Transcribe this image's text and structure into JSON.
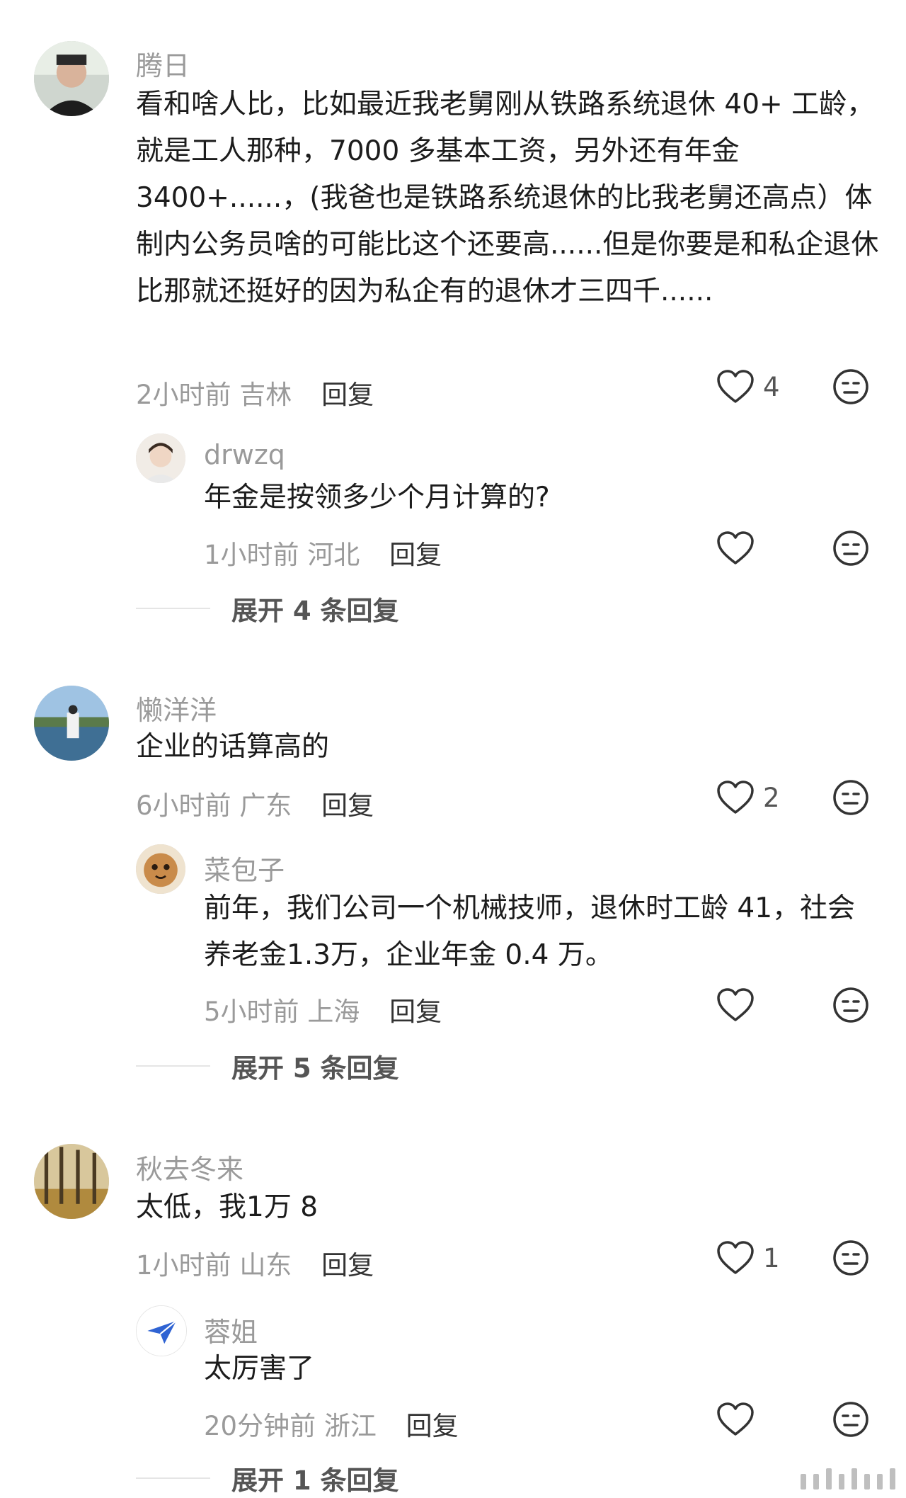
{
  "comments": [
    {
      "user": "腾日",
      "text": "看和啥人比，比如最近我老舅刚从铁路系统退休 40+ 工龄，就是工人那种，7000 多基本工资，另外还有年金 3400+......，(我爸也是铁路系统退休的比我老舅还高点）体制内公务员啥的可能比这个还要高......但是你要是和私企退休比那就还挺好的因为私企有的退休才三四千......",
      "time": "2小时前",
      "location": "吉林",
      "reply": "回复",
      "likes": "4",
      "sub": {
        "user": "drwzq",
        "text": "年金是按领多少个月计算的?",
        "time": "1小时前",
        "location": "河北",
        "reply": "回复"
      },
      "expand": "展开 4 条回复"
    },
    {
      "user": "懒洋洋",
      "text": "企业的话算高的",
      "time": "6小时前",
      "location": "广东",
      "reply": "回复",
      "likes": "2",
      "sub": {
        "user": "菜包子",
        "text": "前年，我们公司一个机械技师，退休时工龄 41，社会养老金1.3万，企业年金 0.4 万。",
        "time": "5小时前",
        "location": "上海",
        "reply": "回复"
      },
      "expand": "展开 5 条回复"
    },
    {
      "user": "秋去冬来",
      "text": "太低，我1万 8",
      "time": "1小时前",
      "location": "山东",
      "reply": "回复",
      "likes": "1",
      "sub": {
        "user": "蓉姐",
        "text": "太厉害了",
        "time": "20分钟前",
        "location": "浙江",
        "reply": "回复"
      },
      "expand": "展开 1 条回复"
    }
  ],
  "icons": {
    "like": "heart-outline-icon",
    "emoji": "neutral-face-icon"
  },
  "colors": {
    "meta": "#9a9a9a",
    "text": "#1c1c1c"
  }
}
